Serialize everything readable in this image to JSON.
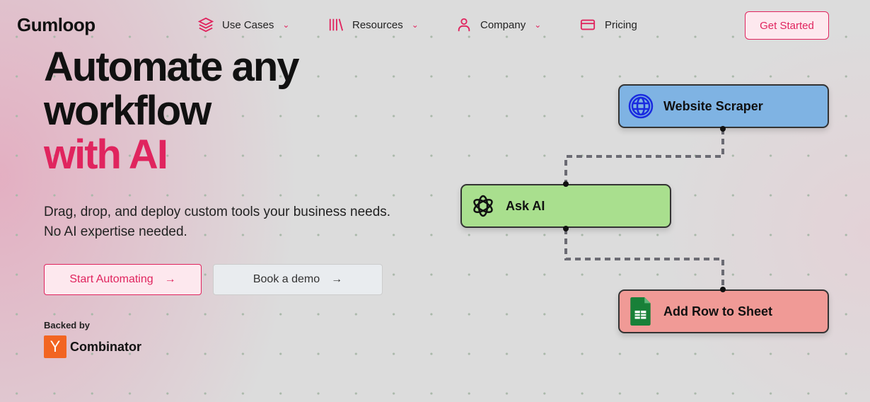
{
  "nav": {
    "logo": "Gumloop",
    "items": [
      {
        "label": "Use Cases",
        "icon": "layers-icon"
      },
      {
        "label": "Resources",
        "icon": "library-icon"
      },
      {
        "label": "Company",
        "icon": "user-icon"
      },
      {
        "label": "Pricing",
        "icon": "credit-card-icon"
      }
    ],
    "cta": "Get Started"
  },
  "hero": {
    "title_line1": "Automate any",
    "title_line2": "workflow",
    "title_line3": "with AI",
    "subtitle_line1": "Drag, drop, and deploy custom tools your business needs.",
    "subtitle_line2": "No AI expertise needed.",
    "primary_button": "Start Automating",
    "secondary_button": "Book a demo",
    "arrow": "→",
    "backed_by": "Backed by",
    "yc_logo": "Y",
    "yc_name": "Combinator"
  },
  "workflow": {
    "nodes": [
      {
        "label": "Website Scraper",
        "icon": "globe-icon",
        "color": "#7fb3e3"
      },
      {
        "label": "Ask AI",
        "icon": "openai-icon",
        "color": "#a9df8e"
      },
      {
        "label": "Add Row to Sheet",
        "icon": "google-sheets-icon",
        "color": "#f09a96"
      }
    ]
  },
  "colors": {
    "accent": "#e0245e"
  }
}
